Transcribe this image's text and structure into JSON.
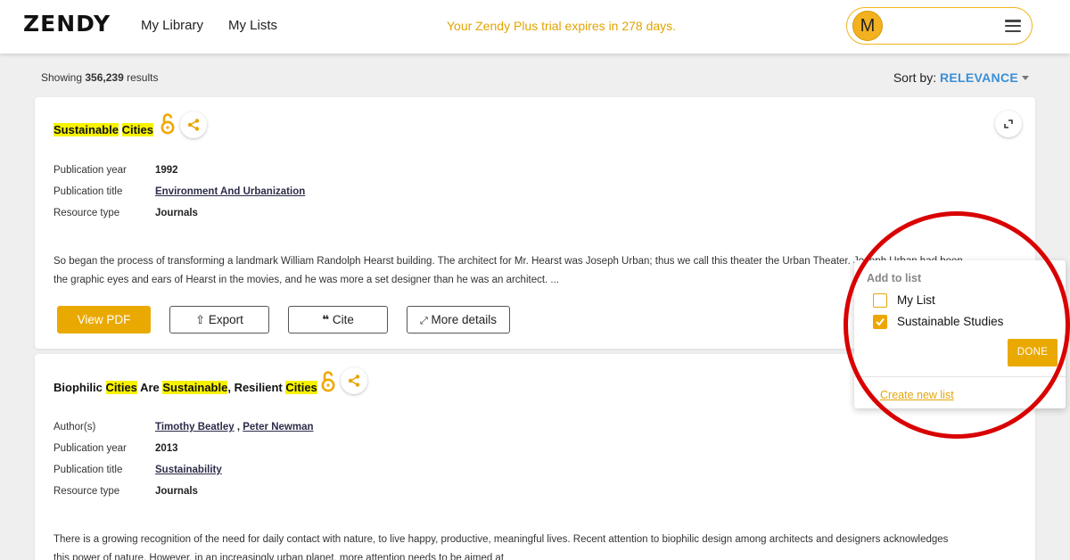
{
  "header": {
    "logo": "ZENDY",
    "nav": [
      "My Library",
      "My Lists"
    ],
    "trial_notice": "Your Zendy Plus trial expires in 278 days.",
    "avatar_initial": "M"
  },
  "results": {
    "showing_prefix": "Showing",
    "count": "356,239",
    "showing_suffix": "results",
    "sort_label": "Sort by:",
    "sort_value": "RELEVANCE"
  },
  "cards": [
    {
      "title_parts": [
        "Sustainable",
        "Cities"
      ],
      "meta": [
        {
          "label": "Publication year",
          "value": "1992"
        },
        {
          "label": "Publication title",
          "value": "Environment And Urbanization"
        },
        {
          "label": "Resource type",
          "value": "Journals"
        }
      ],
      "abstract_line1": "So began the process of transforming a landmark William Randolph Hearst building. The architect for Mr. Hearst was Joseph Urban; thus we call this theater the Urban Theater. Joseph Urban had been",
      "abstract_line2": "the graphic eyes and ears of Hearst in the movies, and he was more a set designer than he was an architect. ...",
      "buttons": {
        "view_pdf": "View PDF",
        "export": "Export",
        "cite": "Cite",
        "more_details": "More details"
      }
    },
    {
      "title_parts": [
        "Biophilic",
        "Cities",
        "Are",
        "Sustainable",
        ", Resilient",
        "Cities"
      ],
      "meta": [
        {
          "label": "Author(s)",
          "value": ""
        },
        {
          "label": "Publication year",
          "value": "2013"
        },
        {
          "label": "Publication title",
          "value": "Sustainability"
        },
        {
          "label": "Resource type",
          "value": "Journals"
        }
      ],
      "authors": [
        "Timothy Beatley",
        "Peter Newman"
      ],
      "author_sep": ",",
      "abstract_line1": "There is a growing recognition of the need for daily contact with nature, to live happy, productive, meaningful lives. Recent attention to biophilic design among architects and designers acknowledges",
      "abstract_line2": "this power of nature. However, in an increasingly urban planet, more attention needs to be aimed at"
    }
  ],
  "add_to_list_popup": {
    "title": "Add to list",
    "options": [
      {
        "label": "My List",
        "checked": false
      },
      {
        "label": "Sustainable Studies",
        "checked": true
      }
    ],
    "done": "DONE",
    "create_new": "Create new list"
  },
  "colors": {
    "accent": "#eaa900",
    "highlight": "#f7f200",
    "sort_blue": "#3b8fd6",
    "annotation_red": "#d90000"
  }
}
